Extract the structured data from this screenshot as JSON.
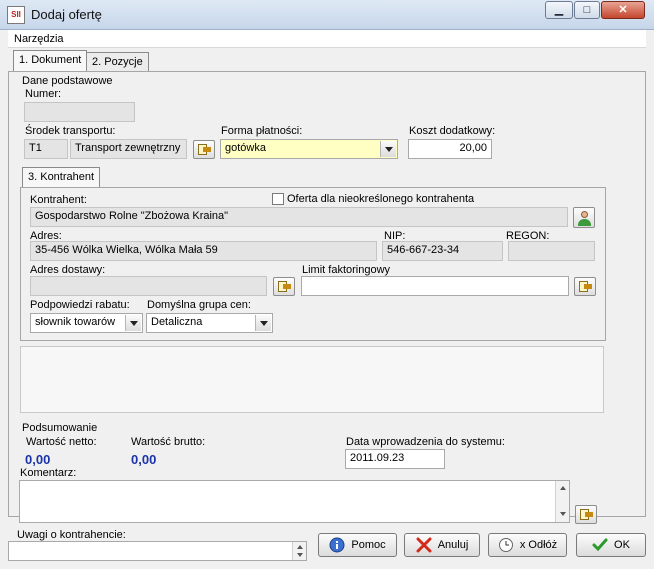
{
  "window": {
    "title": "Dodaj ofertę",
    "app_icon_text": "SII",
    "minimize_glyph": "▁",
    "maximize_glyph": "□",
    "close_glyph": "✕"
  },
  "menu": {
    "tools": "Narzędzia"
  },
  "tabs": {
    "document": "1. Dokument",
    "positions": "2. Pozycje"
  },
  "basic": {
    "group_label": "Dane podstawowe",
    "number_label": "Numer:",
    "number_value": "",
    "transport_label": "Środek transportu:",
    "transport_code": "T1",
    "transport_name": "Transport zewnętrzny",
    "payment_label": "Forma płatności:",
    "payment_value": "gotówka",
    "extra_cost_label": "Koszt dodatkowy:",
    "extra_cost_value": "20,00"
  },
  "contractor_tab": "3. Kontrahent",
  "contractor": {
    "label": "Kontrahent:",
    "undefined_checkbox": "Oferta dla nieokreślonego kontrahenta",
    "name": "Gospodarstwo Rolne \"Zbożowa Kraina\"",
    "address_label": "Adres:",
    "address": "35-456 Wólka Wielka, Wólka Mała 59",
    "nip_label": "NIP:",
    "nip": "546-667-23-34",
    "regon_label": "REGON:",
    "regon": "",
    "delivery_label": "Adres dostawy:",
    "delivery_value": "",
    "limit_label": "Limit faktoringowy",
    "limit_value": "",
    "discount_label": "Podpowiedzi rabatu:",
    "discount_value": "słownik towarów",
    "price_group_label": "Domyślna grupa cen:",
    "price_group_value": "Detaliczna"
  },
  "summary": {
    "group_label": "Podsumowanie",
    "net_label": "Wartość netto:",
    "net_value": "0,00",
    "gross_label": "Wartość brutto:",
    "gross_value": "0,00",
    "date_label": "Data wprowadzenia do systemu:",
    "date_value": "2011.09.23",
    "comment_label": "Komentarz:",
    "comment_value": ""
  },
  "footer": {
    "remarks_label": "Uwagi o kontrahencie:",
    "remarks_value": "",
    "help": "Pomoc",
    "cancel": "Anuluj",
    "postpone": "x Odłóż",
    "ok": "OK"
  }
}
